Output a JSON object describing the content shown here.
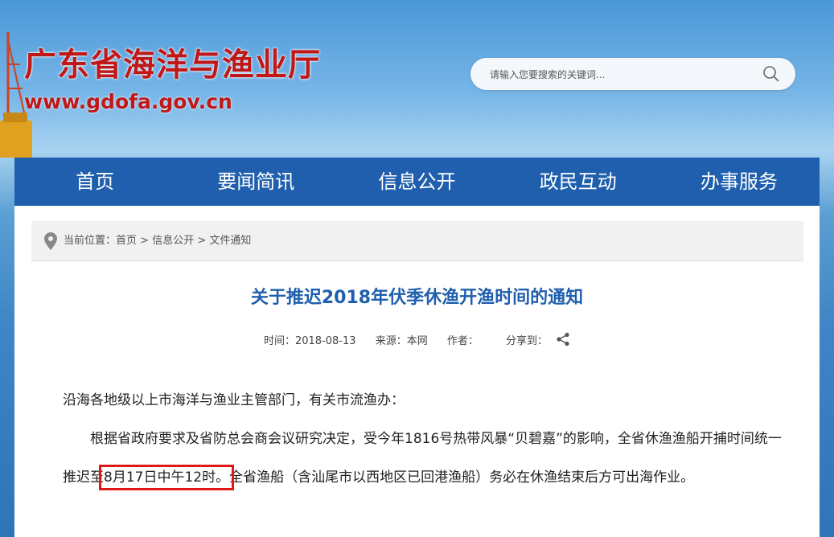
{
  "header": {
    "title": "广东省海洋与渔业厅",
    "url": "www.gdofa.gov.cn",
    "search_placeholder": "请输入您要搜索的关键词...",
    "search_icon": "search-icon"
  },
  "nav": {
    "items": [
      {
        "label": "首页"
      },
      {
        "label": "要闻简讯"
      },
      {
        "label": "信息公开"
      },
      {
        "label": "政民互动"
      },
      {
        "label": "办事服务"
      }
    ]
  },
  "breadcrumb": {
    "prefix": "当前位置：",
    "items": [
      "首页",
      "信息公开",
      "文件通知"
    ],
    "separator": " > "
  },
  "article": {
    "title": "关于推迟2018年伏季休渔开渔时间的通知",
    "meta": {
      "time": "时间：2018-08-13",
      "source": "来源：本网",
      "author": "作者：",
      "share": "分享到："
    },
    "greeting": "沿海各地级以上市海洋与渔业主管部门，有关市流渔办：",
    "para_before": "根据省政府要求及省防总会商会议研究决定，受今年1816号热带风暴“贝碧嘉”的影响，全省休渔渔船开捕时间统一推迟至",
    "para_highlight": "8月17日中午12时。",
    "para_after": "全省渔船（含汕尾市以西地区已回港渔船）务必在休渔结束后方可出海作业。"
  },
  "colors": {
    "title_red": "#c01818",
    "nav_blue": "#1f5fad",
    "highlight_red": "#e01818"
  }
}
